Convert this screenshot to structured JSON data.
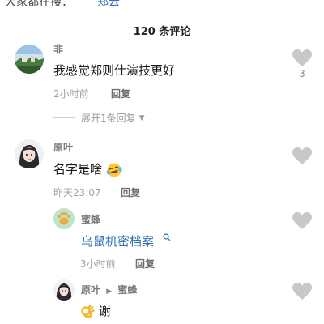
{
  "top_strip": {
    "left_text": "大家都在搜：",
    "link_text": "郑云"
  },
  "header": {
    "count": "120",
    "label": "条评论"
  },
  "comments": [
    {
      "name": "非",
      "text": "我感觉郑则仕演技更好",
      "time": "2小时前",
      "reply_label": "回复",
      "likes": "3",
      "expand_label": "展开1条回复",
      "avatar": "landscape-avatar"
    },
    {
      "name": "原叶",
      "text": "名字是啥",
      "time": "昨天23:07",
      "reply_label": "回复",
      "emoji": "laughing-crying-emoji",
      "avatar": "girl-avatar"
    }
  ],
  "replies": [
    {
      "name": "蜜蜂",
      "link_text": "乌鼠机密档案",
      "time": "3小时前",
      "reply_label": "回复",
      "avatar": "paw-avatar"
    },
    {
      "name": "原叶",
      "reply_to": "蜜蜂",
      "text": "谢",
      "emoji": "ok-hand-emoji",
      "avatar": "girl-avatar"
    }
  ],
  "colors": {
    "link": "#2f6db3",
    "meta": "#a3a3a3",
    "heart": "#c8c8c8"
  }
}
